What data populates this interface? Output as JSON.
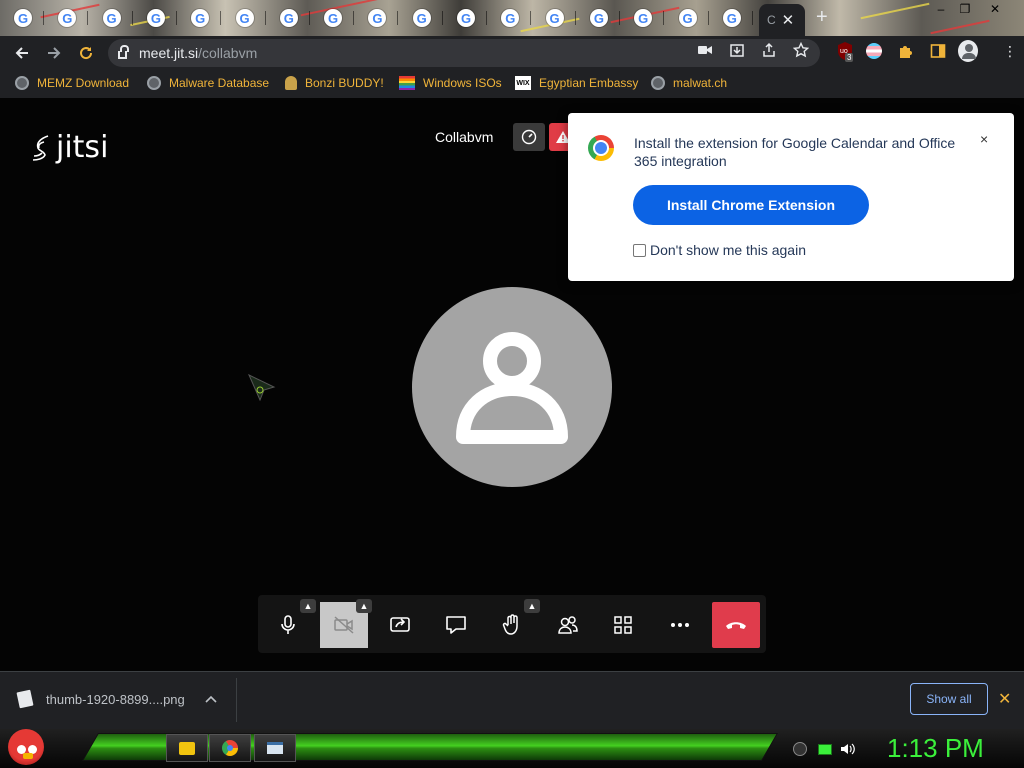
{
  "browser": {
    "tab_count_google": 17,
    "active_tab": {
      "label": "C",
      "close": "✕"
    },
    "new_tab": "+",
    "window_controls": {
      "minimize": "–",
      "maximize": "❐",
      "close": "✕"
    },
    "url": {
      "host": "meet.jit.si",
      "path": "/collabvm"
    },
    "extension_badge": "3"
  },
  "bookmarks": [
    {
      "label": "MEMZ Download",
      "icon": "globe-icon"
    },
    {
      "label": "Malware Database",
      "icon": "globe-icon"
    },
    {
      "label": "Bonzi BUDDY!",
      "icon": "bonzi-icon"
    },
    {
      "label": "Windows ISOs",
      "icon": "rainbow-flag-icon"
    },
    {
      "label": "Egyptian Embassy",
      "icon": "wix-icon"
    },
    {
      "label": "malwat.ch",
      "icon": "globe-icon"
    }
  ],
  "jitsi": {
    "logo_text": "jitsi",
    "conference_name": "Collabvm",
    "warning_icon": "!"
  },
  "extension_popup": {
    "message": "Install the extension for Google Calendar and Office 365 integration",
    "install_button": "Install Chrome Extension",
    "dont_show_label": "Don't show me this again",
    "close": "×"
  },
  "download_bar": {
    "filename": "thumb-1920-8899....png",
    "show_all": "Show all",
    "close": "✕",
    "chevron": "^"
  },
  "taskbar": {
    "clock": "1:13 PM"
  },
  "colors": {
    "accent_link": "#f0b43a",
    "install_button": "#0c63e4",
    "hangup": "#e03c4c",
    "clock": "#3bf03b"
  }
}
